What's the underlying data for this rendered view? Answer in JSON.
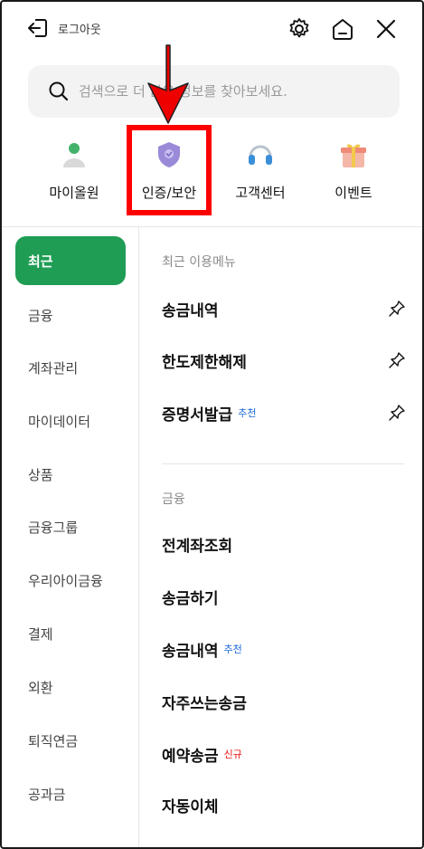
{
  "header": {
    "logout_label": "로그아웃"
  },
  "search": {
    "placeholder": "검색으로 더 많은 정보를 찾아보세요."
  },
  "quick_menu": [
    {
      "label": "마이올원",
      "icon": "person-icon"
    },
    {
      "label": "인증/보안",
      "icon": "shield-icon"
    },
    {
      "label": "고객센터",
      "icon": "headset-icon"
    },
    {
      "label": "이벤트",
      "icon": "gift-icon"
    }
  ],
  "sidebar": {
    "items": [
      {
        "label": "최근",
        "active": true
      },
      {
        "label": "금융"
      },
      {
        "label": "계좌관리"
      },
      {
        "label": "마이데이터"
      },
      {
        "label": "상품"
      },
      {
        "label": "금융그룹"
      },
      {
        "label": "우리아이금융"
      },
      {
        "label": "결제"
      },
      {
        "label": "외환"
      },
      {
        "label": "퇴직연금"
      },
      {
        "label": "공과금"
      }
    ]
  },
  "recent": {
    "title": "최근 이용메뉴",
    "items": [
      {
        "label": "송금내역"
      },
      {
        "label": "한도제한해제"
      },
      {
        "label": "증명서발급",
        "tag": "추천"
      }
    ]
  },
  "finance": {
    "title": "금융",
    "items": [
      {
        "label": "전계좌조회"
      },
      {
        "label": "송금하기"
      },
      {
        "label": "송금내역",
        "tag": "추천"
      },
      {
        "label": "자주쓰는송금"
      },
      {
        "label": "예약송금",
        "tag": "신규"
      },
      {
        "label": "자동이체"
      }
    ]
  },
  "colors": {
    "accent": "#1f9d55",
    "highlight": "#ff0000",
    "recommend_tag": "#1a66d6",
    "new_tag": "#ee1111"
  }
}
